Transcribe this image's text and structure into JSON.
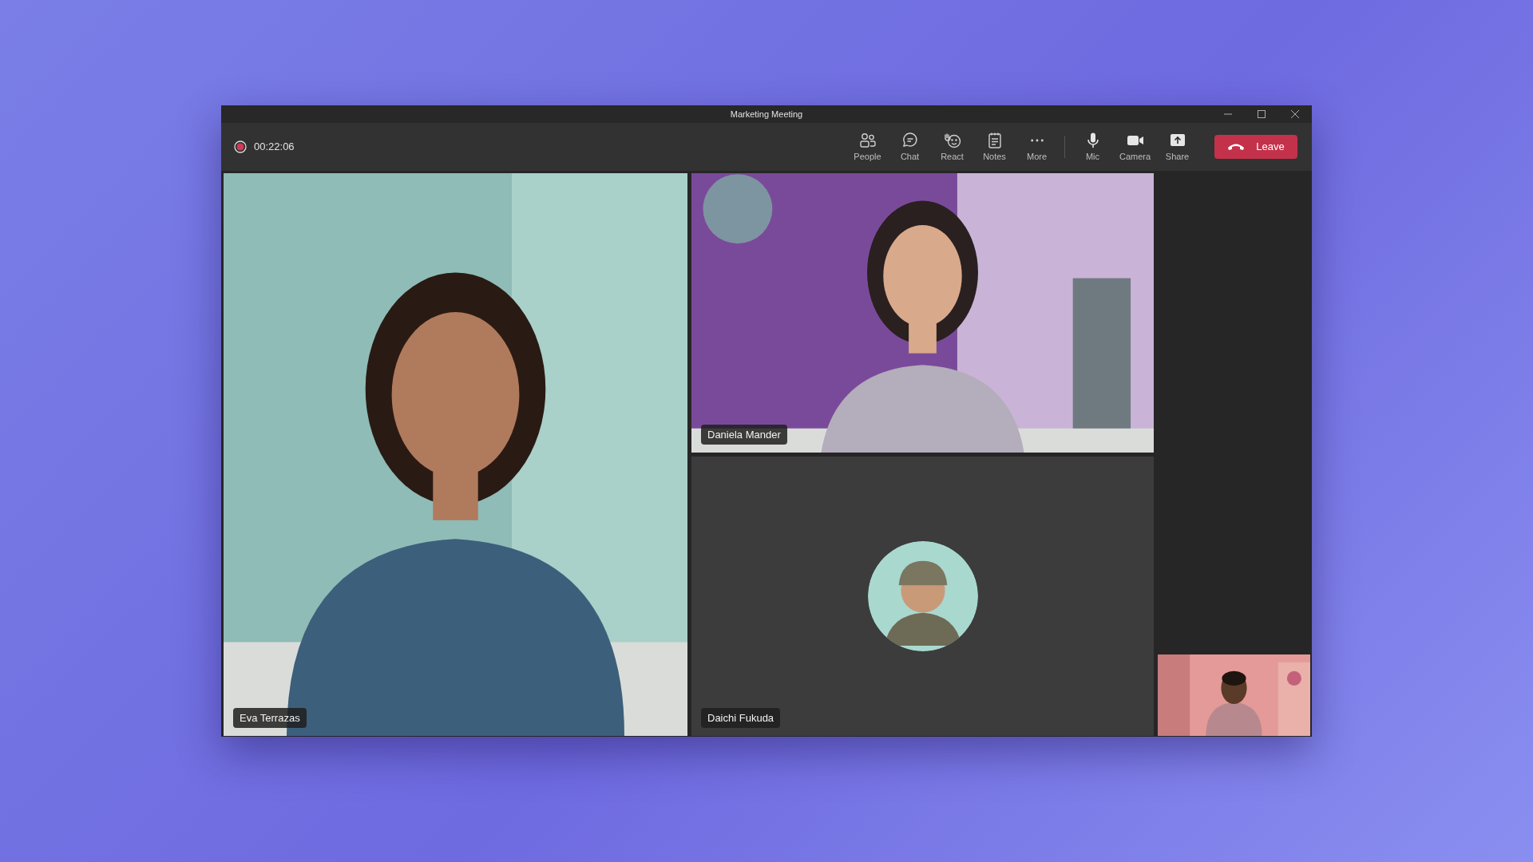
{
  "window": {
    "title": "Marketing Meeting"
  },
  "recording": {
    "on": true,
    "time": "00:22:06"
  },
  "toolbar": [
    {
      "label": "People",
      "kind": "people"
    },
    {
      "label": "Chat",
      "kind": "chat"
    },
    {
      "label": "React",
      "kind": "react"
    },
    {
      "label": "Notes",
      "kind": "notes"
    },
    {
      "label": "More",
      "kind": "more"
    }
  ],
  "device_controls": [
    {
      "label": "Mic",
      "kind": "mic"
    },
    {
      "label": "Camera",
      "kind": "camera"
    },
    {
      "label": "Share",
      "kind": "share"
    }
  ],
  "leave_button": {
    "label": "Leave"
  },
  "participants": [
    {
      "name": "Eva Terrazas",
      "kind": "video"
    },
    {
      "name": "Daniela Mander",
      "kind": "video"
    },
    {
      "name": "Daichi Fukuda",
      "kind": "avatar"
    }
  ],
  "self_view": {
    "kind": "video"
  }
}
